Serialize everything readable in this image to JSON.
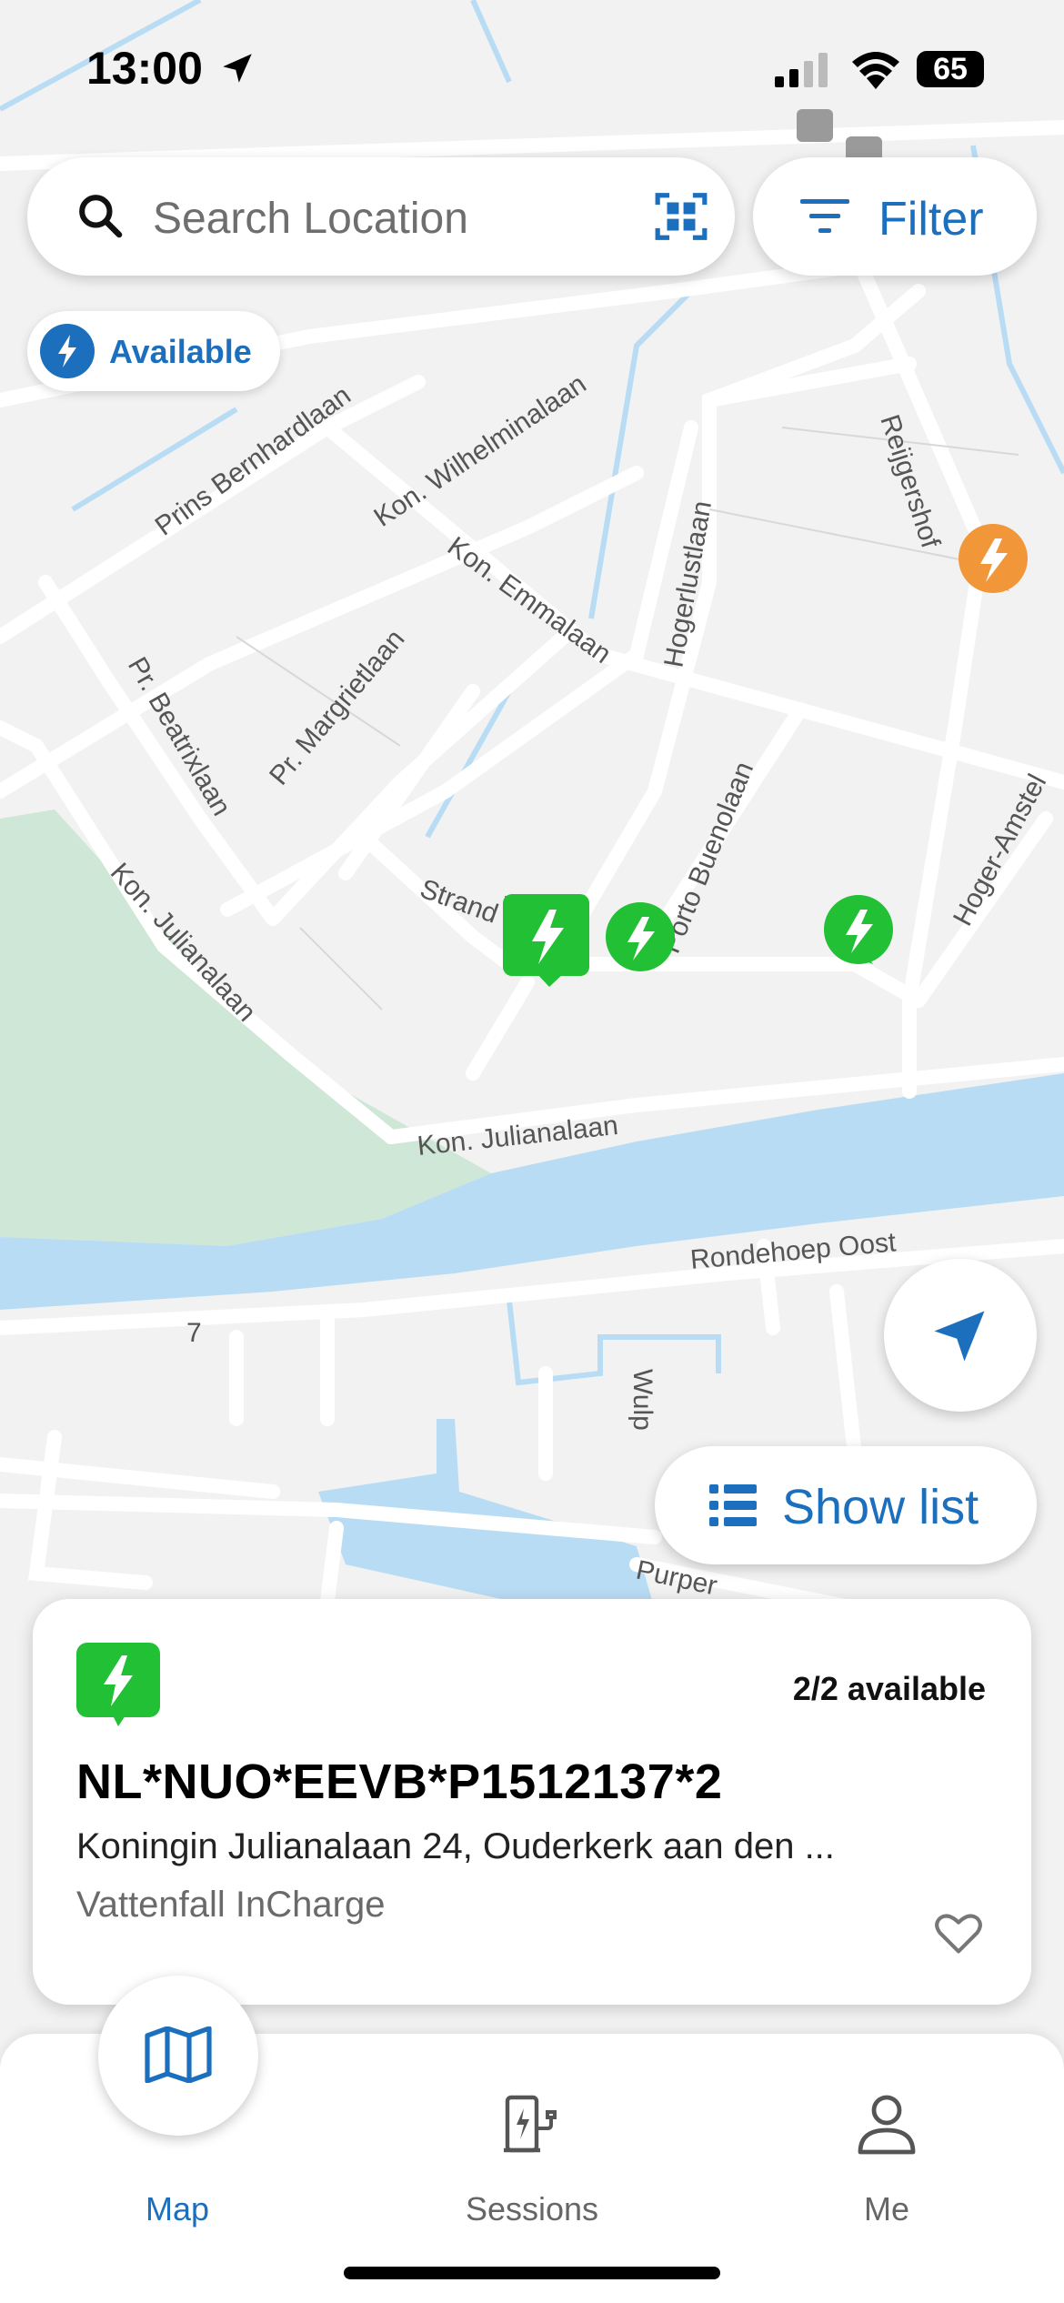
{
  "status_bar": {
    "time": "13:00",
    "battery": "65"
  },
  "search": {
    "placeholder": "Search Location"
  },
  "filter": {
    "label": "Filter"
  },
  "available_chip": {
    "label": "Available"
  },
  "map": {
    "street_labels": [
      "Kon. Wilhelminalaan",
      "Prins Bernhardlaan",
      "Kon. Emmalaan",
      "Hogerlustlaan",
      "Reijgershof",
      "Pr. Margrietlaan",
      "Pr. Beatrixlaan",
      "Kon. Julianalaan",
      "Porto Buenolaan",
      "Hoger-Amstel",
      "Strand",
      "Kon. Julianalaan",
      "Rondehoep Oost",
      "7",
      "Wulp",
      "Purper"
    ]
  },
  "show_list": {
    "label": "Show list"
  },
  "station_card": {
    "availability": "2/2 available",
    "id": "NL*NUO*EEVB*P1512137*2",
    "address": "Koningin Julianalaan 24, Ouderkerk aan den ...",
    "operator": "Vattenfall InCharge"
  },
  "tabs": [
    {
      "label": "Map"
    },
    {
      "label": "Sessions"
    },
    {
      "label": "Me"
    }
  ],
  "colors": {
    "accent": "#1c6fbd",
    "available_green": "#22c034",
    "busy_orange": "#f2963a",
    "water": "#b9dcf5",
    "park": "#cfe7d6"
  }
}
